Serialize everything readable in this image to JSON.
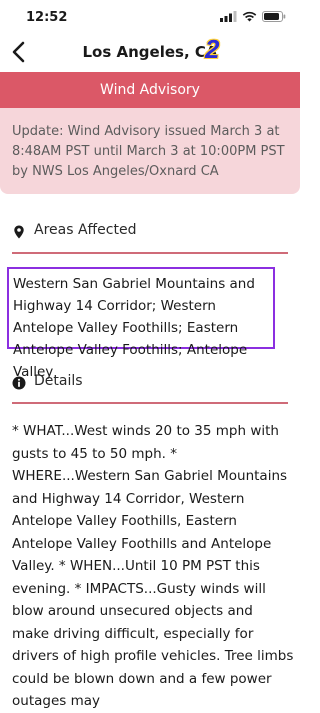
{
  "status_bar": {
    "time": "12:52"
  },
  "nav": {
    "title": "Los Angeles, CA",
    "annotation_number": "2"
  },
  "alert": {
    "header": "Wind Advisory",
    "body": "Update: Wind Advisory issued March 3 at 8:48AM PST until March 3 at 10:00PM PST by NWS Los Angeles/Oxnard CA"
  },
  "areas": {
    "label": "Areas Affected",
    "text": "Western San Gabriel Mountains and Highway 14 Corridor; Western Antelope Valley Foothills; Eastern Antelope Valley Foothills; Antelope Valley"
  },
  "details": {
    "label": "Details",
    "text": "* WHAT...West winds 20 to 35 mph with gusts to 45 to 50 mph. * WHERE...Western San Gabriel Mountains and Highway 14 Corridor, Western Antelope Valley Foothills, Eastern Antelope Valley Foothills and Antelope Valley. * WHEN...Until 10 PM PST this evening. * IMPACTS...Gusty winds will blow around unsecured objects and make driving difficult, especially for drivers of high profile vehicles. Tree limbs could be blown down and a few power outages may"
  },
  "colors": {
    "alert_header": "#db5867",
    "alert_background": "#f6d6da",
    "divider": "#cf6b78",
    "highlight_box": "#8b2fe0",
    "annotation": "#2b2bd6"
  }
}
